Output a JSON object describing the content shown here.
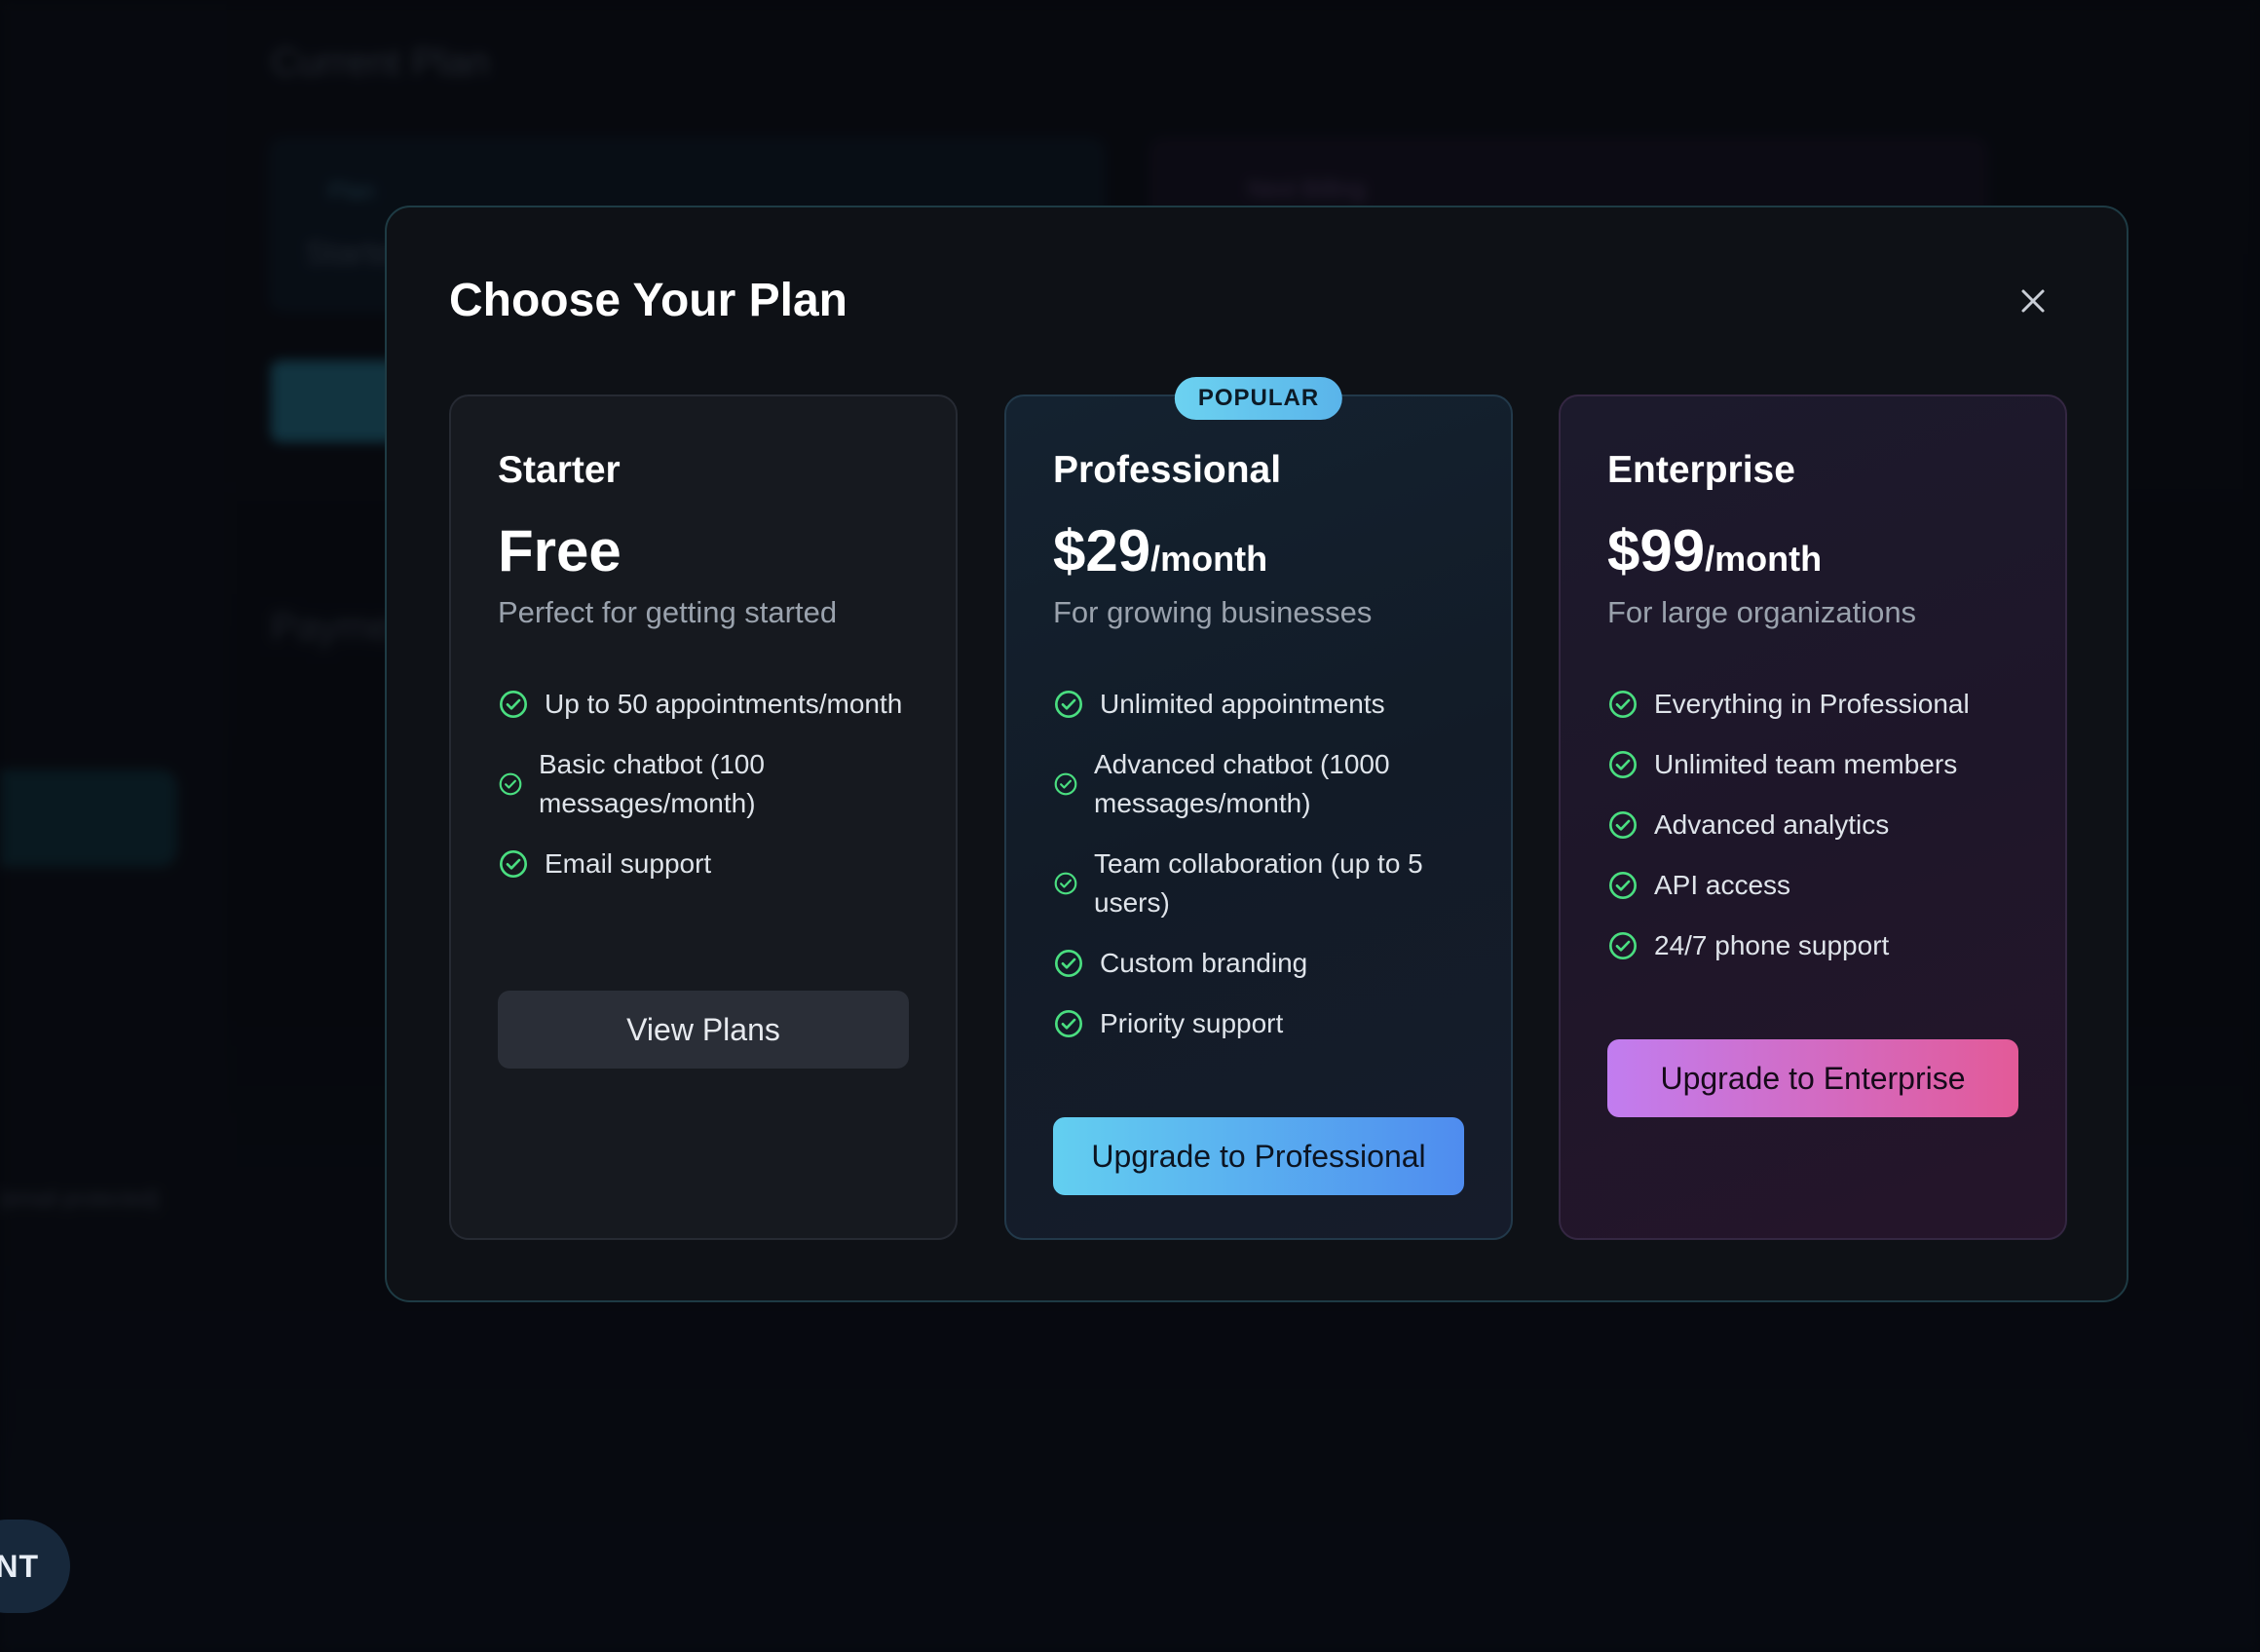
{
  "background": {
    "page_title": "Current Plan",
    "plan_card_label": "Plan",
    "plan_card_value": "Starter",
    "billing_card_label": "Next Billing",
    "payment_heading": "Payment",
    "sidebar_footer_text": "[email protected]",
    "agent_button_label": "AGENT"
  },
  "modal": {
    "title": "Choose Your Plan",
    "close_icon": "close-icon",
    "plans": [
      {
        "name": "Starter",
        "price": "Free",
        "period": "",
        "description": "Perfect for getting started",
        "features": [
          "Up to 50 appointments/month",
          "Basic chatbot (100 messages/month)",
          "Email support"
        ],
        "button_label": "View Plans"
      },
      {
        "badge": "POPULAR",
        "name": "Professional",
        "price": "$29",
        "period": "/month",
        "description": "For growing businesses",
        "features": [
          "Unlimited appointments",
          "Advanced chatbot (1000 messages/month)",
          "Team collaboration (up to 5 users)",
          "Custom branding",
          "Priority support"
        ],
        "button_label": "Upgrade to Professional"
      },
      {
        "name": "Enterprise",
        "price": "$99",
        "period": "/month",
        "description": "For large organizations",
        "features": [
          "Everything in Professional",
          "Unlimited team members",
          "Advanced analytics",
          "API access",
          "24/7 phone support"
        ],
        "button_label": "Upgrade to Enterprise"
      }
    ]
  },
  "colors": {
    "check": "#4ade80",
    "accent_cyan": "#63cff0",
    "accent_blue": "#4f8cef",
    "accent_purple": "#c17df0",
    "accent_pink": "#e35a98"
  }
}
